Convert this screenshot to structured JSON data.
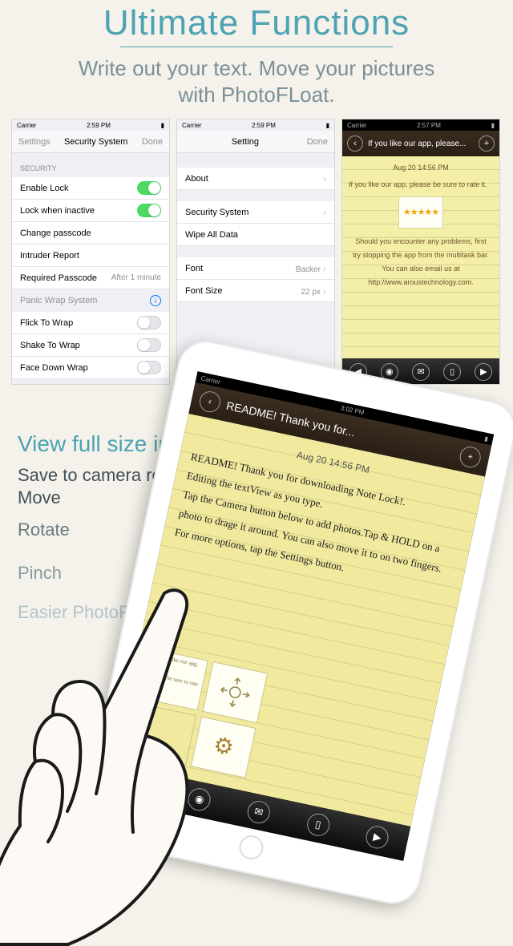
{
  "header": {
    "title": "Ultimate Functions",
    "subtitle_line1": "Write out your text. Move your pictures",
    "subtitle_line2": "with PhotoFLoat."
  },
  "phone1": {
    "status": {
      "carrier": "Carrier",
      "time": "2:59 PM"
    },
    "nav": {
      "left": "Settings",
      "mid": "Security System",
      "right": "Done"
    },
    "section": "SECURITY",
    "rows": {
      "enable_lock": "Enable Lock",
      "lock_inactive": "Lock when inactive",
      "change_passcode": "Change passcode",
      "intruder": "Intruder Report",
      "required": "Required Passcode",
      "required_val": "After 1 minute"
    },
    "panic_title": "Panic Wrap System",
    "panic": {
      "flick": "Flick To Wrap",
      "shake": "Shake To Wrap",
      "facedown": "Face Down Wrap"
    }
  },
  "phone2": {
    "status": {
      "carrier": "Carrier",
      "time": "2:59 PM"
    },
    "nav": {
      "left": "",
      "mid": "Setting",
      "right": "Done"
    },
    "rows": {
      "about": "About",
      "security": "Security System",
      "wipe": "Wipe All Data",
      "font": "Font",
      "font_val": "Backer",
      "fontsize": "Font Size",
      "fontsize_val": "22 px"
    }
  },
  "phone3": {
    "status": {
      "carrier": "Carrier",
      "time": "2:57 PM"
    },
    "nav": {
      "title": "If you like our app, please..."
    },
    "date": "Aug 20   14:56 PM",
    "line1": "If you like our app, please be sure to rate it.",
    "stars": "★★★★★",
    "line2": "Should you encounter any problems, first try stopping the app from the multitask bar. You can also email us at http://www.aroustechnology.com."
  },
  "leftcol": {
    "h2": "View full size images",
    "a": "Save to camera roll",
    "b": "Move",
    "c": "Rotate",
    "d": "Pinch",
    "e": "Easier PhotoFLoat Gestures"
  },
  "ipad": {
    "status": {
      "carrier": "Carrier",
      "time": "3:02 PM"
    },
    "nav": {
      "title": "README! Thank you for..."
    },
    "date": "Aug 20   14:56 PM",
    "p1": "README! Thank you for downloading Note Lock!.",
    "p2": "Editing the textView as you type.",
    "p3": "Tap the Camera button below to add photos.Tap & HOLD on a photo to drage it around. You can also move it to on two fingers.",
    "p4": "For more options, tap the Settings button.",
    "widget_text": "If you like our app, please be sure to rate it."
  },
  "icons": {
    "back": "‹",
    "plus": "+",
    "prev": "◀",
    "next": "▶",
    "camera": "📷",
    "mail": "✉",
    "trash": "🗑",
    "gear": "⚙"
  }
}
